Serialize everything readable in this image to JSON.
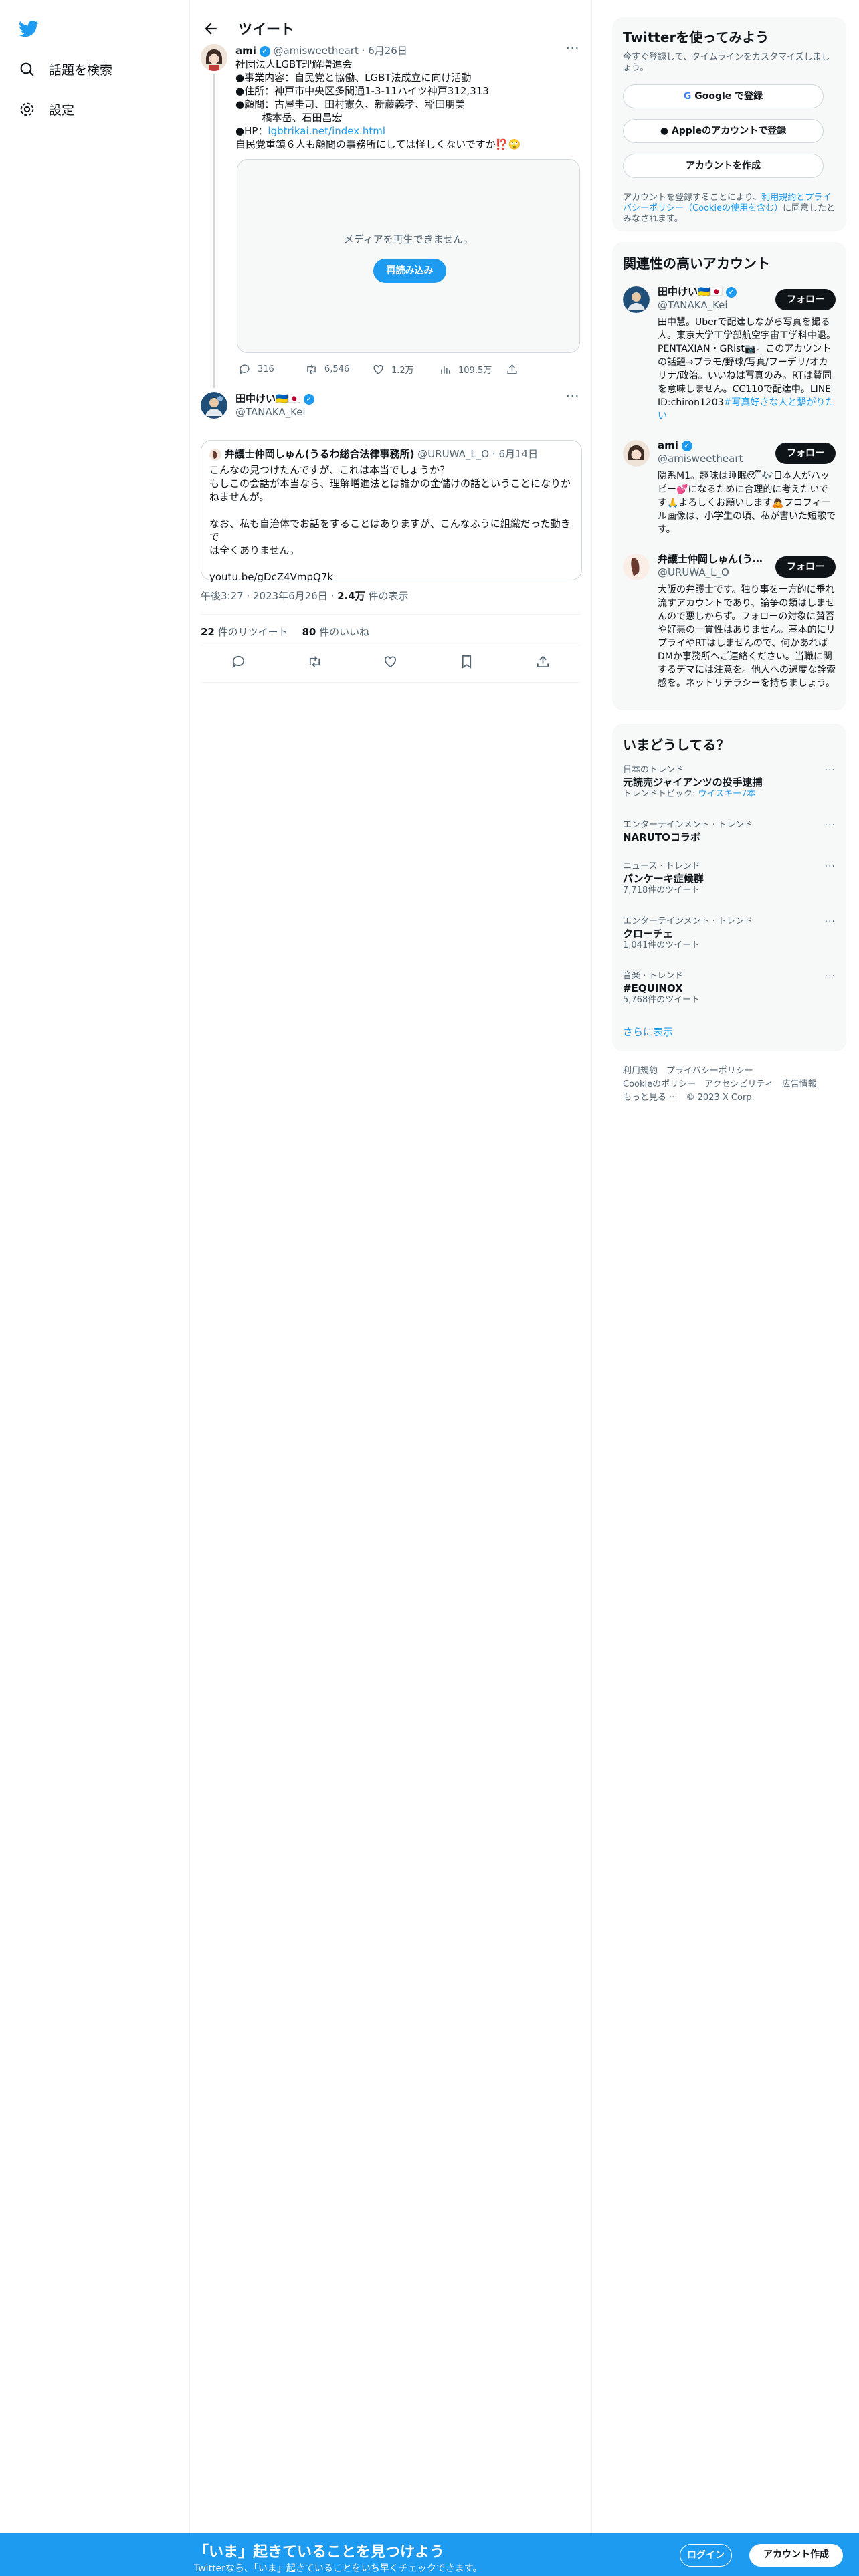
{
  "colors": {
    "accent": "#1d9bf0",
    "text": "#0f1419",
    "muted": "#536471"
  },
  "nav": {
    "explore": "話題を検索",
    "settings": "設定"
  },
  "header": {
    "title": "ツイート"
  },
  "tweet1": {
    "name": "ami",
    "handle": "@amisweetheart",
    "time": "6月26日",
    "lines": [
      "社団法人LGBT理解増進会",
      "●事業内容：自民党と協働、LGBT法成立に向け活動",
      "●住所：神戸市中央区多聞通1-3-11ハイツ神戸312,313",
      "●顧問：古屋圭司、田村憲久、新藤義孝、稲田朋美",
      "　　  橋本岳、石田昌宏"
    ],
    "hp_label": "●HP：",
    "hp_link": "lgbtrikai.net/index.html",
    "last": "自民党重鎮６人も顧問の事務所にしては怪しくないですか⁉️🙄",
    "media_msg": "メディアを再生できません。",
    "retry": "再読み込み",
    "stats": {
      "replies": "316",
      "retweets": "6,546",
      "likes": "1.2万",
      "views": "109.5万"
    }
  },
  "tweet2": {
    "name": "田中けい🇺🇦🇯🇵",
    "handle": "@TANAKA_Kei",
    "quote": {
      "name": "弁護士仲岡しゅん(うるわ総合法律事務所)",
      "handle": "@URUWA_L_O",
      "time": "6月14日",
      "lines": [
        "こんなの見つけたんですが、これは本当でしょうか？",
        "もしこの会話が本当なら、理解増進法とは誰かの金儲けの話ということになりか",
        "ねませんが。",
        "",
        "なお、私も自治体でお話をすることはありますが、こんなふうに組織だった動きで",
        "は全くありません。",
        "",
        "youtu.be/gDcZ4VmpQ7k"
      ]
    },
    "meta": {
      "time": "午後3:27 · 2023年6月26日",
      "dot": " · ",
      "views_num": "2.4万",
      "views_label": " 件の表示"
    },
    "counts": {
      "retweets_num": "22",
      "retweets_label": " 件のリツイート",
      "likes_num": "80",
      "likes_label": " 件のいいね"
    }
  },
  "signup": {
    "title": "Twitterを使ってみよう",
    "sub": "今すぐ登録して、タイムラインをカスタマイズしましょう。",
    "google": "Google で登録",
    "apple": "Appleのアカウントで登録",
    "create": "アカウントを作成",
    "terms_pre": "アカウントを登録することにより、",
    "terms_link": "利用規約とプライバシーポリシー（Cookieの使用を含む）",
    "terms_post": "に同意したとみなされます。"
  },
  "related": {
    "title": "関連性の高いアカウント",
    "follow": "フォロー",
    "accounts": [
      {
        "name": "田中けい🇺🇦🇯🇵",
        "handle": "@TANAKA_Kei",
        "bio": "田中慧。Uberで配達しながら写真を撮る人。東京大学工学部航空宇宙工学科中退。PENTAXIAN・GRist📷。このアカウントの話題→プラモ/野球/写真/フーデリ/オカリナ/政治。いいねは写真のみ。RTは賛同を意味しません。CC110で配達中。LINE ID:chiron1203",
        "tag": "#写真好きな人と繋がりたい"
      },
      {
        "name": "ami",
        "handle": "@amisweetheart",
        "bio": "隠系M1。趣味は睡眠😴🎶日本人がハッピー💕になるために合理的に考えたいです🙏よろしくお願いします🙇プロフィール画像は、小学生の頃、私が書いた短歌です。"
      },
      {
        "name": "弁護士仲岡しゅん(う…",
        "handle": "@URUWA_L_O",
        "bio": "大阪の弁護士です。独り事を一方的に垂れ流すアカウントであり、論争の類はしませんので悪しからず。フォローの対象に賛否や好悪の一貫性はありません。基本的にリプライやRTはしませんので、何かあればDMか事務所へご連絡ください。当職に関するデマには注意を。他人への過度な詮索感を。ネットリテラシーを持ちましょう。"
      }
    ]
  },
  "trends": {
    "title": "いまどうしてる？",
    "more": "さらに表示",
    "items": [
      {
        "category": "日本のトレンド",
        "name": "元読売ジャイアンツの投手逮捕",
        "extra_pre": "トレンドトピック: ",
        "extra_link": "ウイスキー7本"
      },
      {
        "category": "エンターテインメント · トレンド",
        "name": "NARUTOコラボ"
      },
      {
        "category": "ニュース · トレンド",
        "name": "パンケーキ症候群",
        "count": "7,718件のツイート"
      },
      {
        "category": "エンターテインメント · トレンド",
        "name": "クローチェ",
        "count": "1,041件のツイート"
      },
      {
        "category": "音楽 · トレンド",
        "name": "#EQUINOX",
        "count": "5,768件のツイート"
      }
    ]
  },
  "footer": {
    "line1": "利用規約　プライバシーポリシー",
    "line2": "Cookieのポリシー　アクセシビリティ　広告情報",
    "line3": "もっと見る ···　© 2023 X Corp."
  },
  "banner": {
    "title": "「いま」起きていることを見つけよう",
    "sub": "Twitterなら、「いま」起きていることをいち早くチェックできます。",
    "login": "ログイン",
    "signup": "アカウント作成"
  }
}
